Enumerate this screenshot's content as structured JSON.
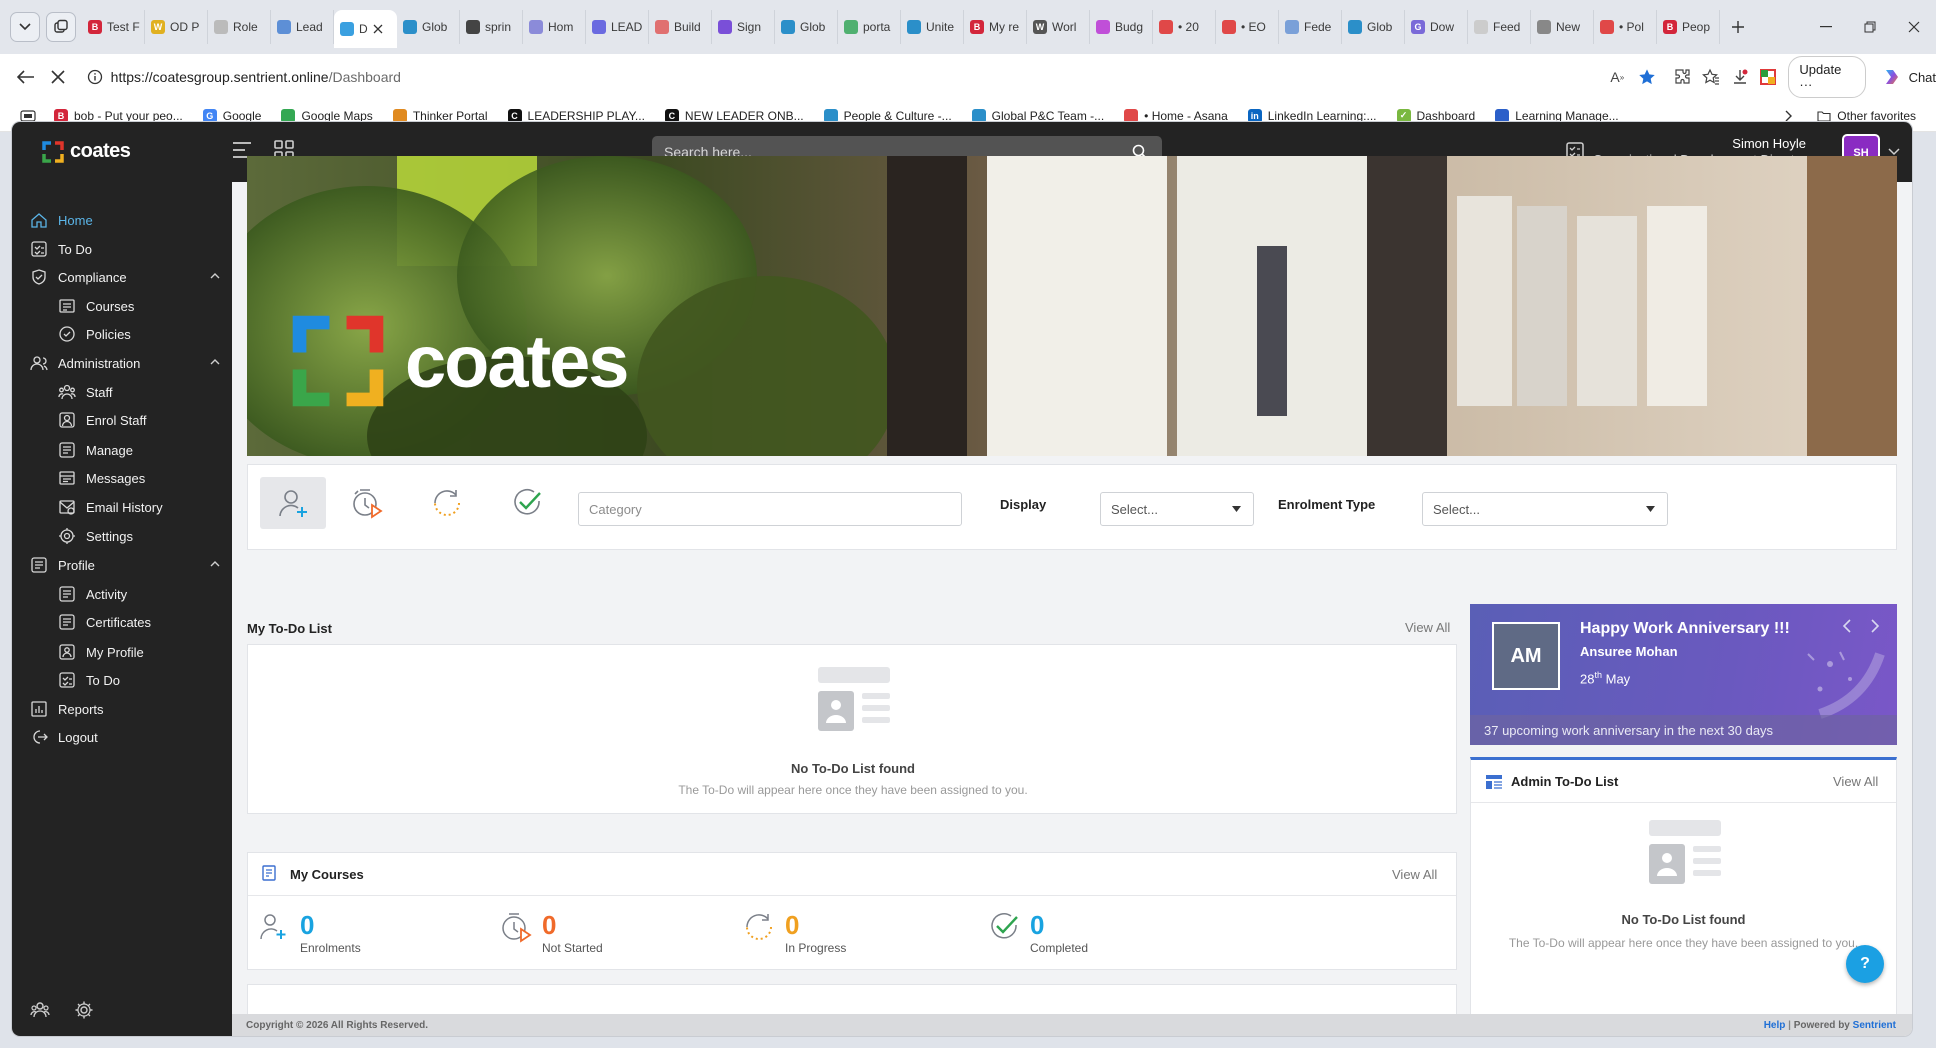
{
  "browser": {
    "tabs": [
      {
        "label": "Test F",
        "color": "#d3263b",
        "glyph": "B"
      },
      {
        "label": "OD P",
        "color": "#e0b020",
        "glyph": "W"
      },
      {
        "label": "Role",
        "color": "#bbbbbb",
        "glyph": ""
      },
      {
        "label": "Lead",
        "color": "#5d8fd6",
        "glyph": ""
      },
      {
        "label": "D",
        "color": "#3aa0e0",
        "glyph": "",
        "active": true
      },
      {
        "label": "Glob",
        "color": "#2b8fc9",
        "glyph": ""
      },
      {
        "label": "sprin",
        "color": "#444444",
        "glyph": ""
      },
      {
        "label": "Hom",
        "color": "#8b8bd9",
        "glyph": ""
      },
      {
        "label": "LEAD",
        "color": "#6a6ae0",
        "glyph": ""
      },
      {
        "label": "Build",
        "color": "#e07070",
        "glyph": ""
      },
      {
        "label": "Sign",
        "color": "#7a4fd8",
        "glyph": ""
      },
      {
        "label": "Glob",
        "color": "#2b8fc9",
        "glyph": ""
      },
      {
        "label": "porta",
        "color": "#50b070",
        "glyph": ""
      },
      {
        "label": "Unite",
        "color": "#2b8fc9",
        "glyph": ""
      },
      {
        "label": "My re",
        "color": "#d3263b",
        "glyph": "B"
      },
      {
        "label": "Worl",
        "color": "#555555",
        "glyph": "W"
      },
      {
        "label": "Budg",
        "color": "#c04fd8",
        "glyph": ""
      },
      {
        "label": "• 20",
        "color": "#e04848",
        "glyph": ""
      },
      {
        "label": "• EO",
        "color": "#e04848",
        "glyph": ""
      },
      {
        "label": "Fede",
        "color": "#7aa0d8",
        "glyph": ""
      },
      {
        "label": "Glob",
        "color": "#2b8fc9",
        "glyph": ""
      },
      {
        "label": "Dow",
        "color": "#7a6ad8",
        "glyph": "G"
      },
      {
        "label": "Feed",
        "color": "#cccccc",
        "glyph": ""
      },
      {
        "label": "New",
        "color": "#888888",
        "glyph": ""
      },
      {
        "label": "• Pol",
        "color": "#e04848",
        "glyph": ""
      },
      {
        "label": "Peop",
        "color": "#d3263b",
        "glyph": "B"
      }
    ],
    "url_host": "https://coatesgroup.sentrient.online",
    "url_path": "/Dashboard",
    "update_label": "Update",
    "chat_label": "Chat",
    "bookmarks": [
      {
        "label": "bob - Put your peo...",
        "color": "#d3263b",
        "glyph": "B"
      },
      {
        "label": "Google",
        "color": "#4285f4",
        "glyph": "G"
      },
      {
        "label": "Google Maps",
        "color": "#34a853",
        "glyph": ""
      },
      {
        "label": "Thinker Portal",
        "color": "#e08a20",
        "glyph": ""
      },
      {
        "label": "LEADERSHIP PLAY...",
        "color": "#111111",
        "glyph": "C"
      },
      {
        "label": "NEW LEADER ONB...",
        "color": "#111111",
        "glyph": "C"
      },
      {
        "label": "People & Culture -...",
        "color": "#2b8fc9",
        "glyph": ""
      },
      {
        "label": "Global P&C Team -...",
        "color": "#2b8fc9",
        "glyph": ""
      },
      {
        "label": "• Home - Asana",
        "color": "#e04848",
        "glyph": ""
      },
      {
        "label": "LinkedIn Learning:...",
        "color": "#0a66c2",
        "glyph": "in"
      },
      {
        "label": "Dashboard",
        "color": "#7ab840",
        "glyph": "✓"
      },
      {
        "label": "Learning Manage...",
        "color": "#2b5fc9",
        "glyph": ""
      }
    ],
    "other_favorites": "Other favorites"
  },
  "app": {
    "logo_text": "coates",
    "search_placeholder": "Search here...",
    "user_name": "Simon Hoyle",
    "user_role": "Organisational Development Director",
    "user_initials": "SH"
  },
  "sidebar": {
    "items": [
      {
        "label": "Home",
        "icon": "home-icon",
        "active": true
      },
      {
        "label": "To Do",
        "icon": "todo-icon"
      },
      {
        "label": "Compliance",
        "icon": "compliance-icon",
        "expandable": true
      },
      {
        "label": "Courses",
        "icon": "courses-icon",
        "sub": true
      },
      {
        "label": "Policies",
        "icon": "policies-icon",
        "sub": true
      },
      {
        "label": "Administration",
        "icon": "administration-icon",
        "expandable": true
      },
      {
        "label": "Staff",
        "icon": "staff-icon",
        "sub": true
      },
      {
        "label": "Enrol Staff",
        "icon": "enrol-staff-icon",
        "sub": true
      },
      {
        "label": "Manage",
        "icon": "manage-icon",
        "sub": true
      },
      {
        "label": "Messages",
        "icon": "messages-icon",
        "sub": true
      },
      {
        "label": "Email History",
        "icon": "email-history-icon",
        "sub": true
      },
      {
        "label": "Settings",
        "icon": "settings-icon",
        "sub": true
      },
      {
        "label": "Profile",
        "icon": "profile-icon",
        "expandable": true
      },
      {
        "label": "Activity",
        "icon": "activity-icon",
        "sub": true
      },
      {
        "label": "Certificates",
        "icon": "certificates-icon",
        "sub": true
      },
      {
        "label": "My Profile",
        "icon": "my-profile-icon",
        "sub": true
      },
      {
        "label": "To Do",
        "icon": "todo-icon",
        "sub": true
      },
      {
        "label": "Reports",
        "icon": "reports-icon"
      },
      {
        "label": "Logout",
        "icon": "logout-icon"
      }
    ]
  },
  "filters": {
    "category_placeholder": "Category",
    "display_label": "Display",
    "display_value": "Select...",
    "enrolment_label": "Enrolment Type",
    "enrolment_value": "Select..."
  },
  "todo": {
    "title": "My To-Do List",
    "view_all": "View All",
    "empty_title": "No To-Do List found",
    "empty_sub": "The To-Do will appear here once they have been assigned to you."
  },
  "courses": {
    "title": "My Courses",
    "view_all": "View All",
    "stats": [
      {
        "value": "0",
        "label": "Enrolments",
        "color": "#19a3e0"
      },
      {
        "value": "0",
        "label": "Not Started",
        "color": "#f06a2a"
      },
      {
        "value": "0",
        "label": "In Progress",
        "color": "#f0a020"
      },
      {
        "value": "0",
        "label": "Completed",
        "color": "#19a3e0"
      }
    ]
  },
  "anniversary": {
    "title": "Happy Work Anniversary !!!",
    "name": "Ansuree Mohan",
    "day": "28",
    "suffix": "th",
    "month": "May",
    "initials": "AM",
    "footer": "37 upcoming work anniversary in the next 30 days"
  },
  "admin_todo": {
    "title": "Admin To-Do List",
    "view_all": "View All",
    "empty_title": "No To-Do List found",
    "empty_sub": "The To-Do will appear here once they have been assigned to you."
  },
  "footer": {
    "copyright": "Copyright © 2026 All Rights Reserved.",
    "help": "Help",
    "powered_by": "Powered by",
    "brand": "Sentrient"
  },
  "help_button": "?"
}
